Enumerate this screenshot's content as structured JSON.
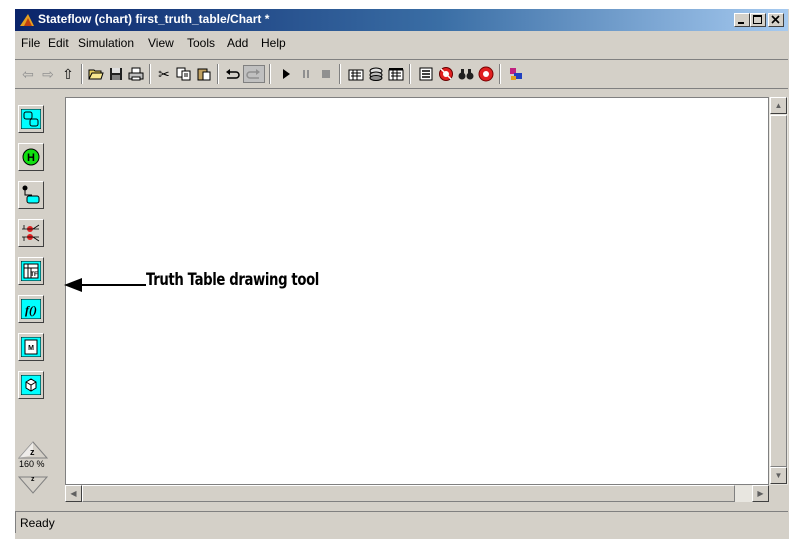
{
  "window": {
    "title": "Stateflow (chart) first_truth_table/Chart *"
  },
  "menu": [
    "File",
    "Edit",
    "Simulation",
    "View",
    "Tools",
    "Add",
    "Help"
  ],
  "toolbar": {
    "icons": [
      "back-arrow-icon",
      "forward-arrow-icon",
      "up-arrow-icon",
      "open-folder-icon",
      "save-disk-icon",
      "print-icon",
      "cut-icon",
      "copy-icon",
      "paste-icon",
      "undo-icon",
      "redo-icon",
      "start-icon",
      "pause-icon",
      "stop-icon",
      "build-icon",
      "rebuild-icon",
      "target-icon",
      "explorer-icon",
      "debugger-icon",
      "find-icon",
      "record-icon",
      "model-icon"
    ]
  },
  "palette": {
    "tools": [
      "state-tool",
      "history-junction-tool",
      "default-transition-tool",
      "connective-junction-tool",
      "truth-table-tool",
      "graphical-function-tool",
      "embedded-matlab-tool",
      "box-tool"
    ],
    "zoom_letter": "z",
    "zoom_level": "160 %"
  },
  "annotation": "Truth Table drawing tool",
  "status": "Ready"
}
